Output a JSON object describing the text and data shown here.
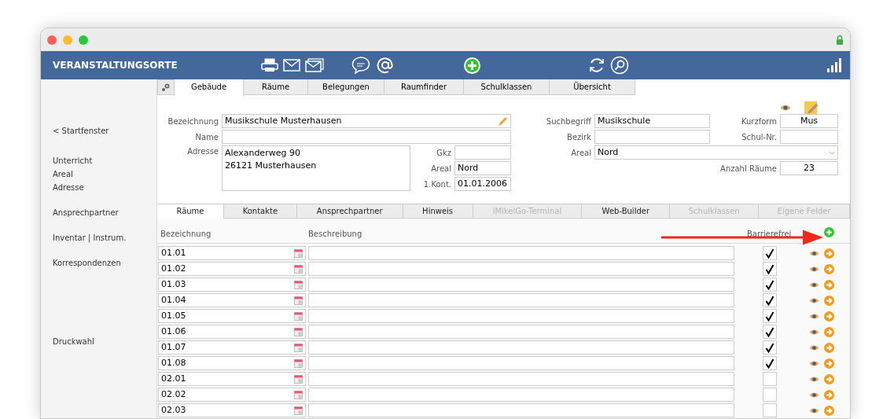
{
  "header": {
    "title": "VERANSTALTUNGSORTE"
  },
  "sidebar": {
    "groups": [
      [
        "< Startfenster"
      ],
      [
        "Unterricht",
        "Areal",
        "Adresse"
      ],
      [
        "Ansprechpartner"
      ],
      [
        "Inventar | Instrum."
      ],
      [
        "Korrespondenzen"
      ],
      [
        "Druckwahl"
      ]
    ]
  },
  "tabs": [
    {
      "label": "Gebäude",
      "selected": true
    },
    {
      "label": "Räume",
      "selected": false
    },
    {
      "label": "Belegungen",
      "selected": false
    },
    {
      "label": "Raumfinder",
      "selected": false
    },
    {
      "label": "Schulklassen",
      "selected": false
    },
    {
      "label": "Übersicht",
      "selected": false
    }
  ],
  "form": {
    "bezeichnung": {
      "label": "Bezeichnung",
      "value": "Musikschule Musterhausen"
    },
    "name": {
      "label": "Name"
    },
    "adresse": {
      "label": "Adresse",
      "lines": [
        "Alexanderweg 90",
        "26121 Musterhausen"
      ]
    },
    "gkz": {
      "label": "Gkz"
    },
    "areal_left": {
      "label": "Areal",
      "value": "Nord"
    },
    "kont": {
      "label": "1.Kont.",
      "value": "01.01.2006"
    },
    "suchbegriff": {
      "label": "Suchbegriff",
      "value": "Musikschule"
    },
    "kurzform": {
      "label": "Kurzform",
      "value": "Mus"
    },
    "bezirk": {
      "label": "Bezirk"
    },
    "schulnr": {
      "label": "Schul-Nr."
    },
    "areal_right": {
      "label": "Areal",
      "value": "Nord"
    },
    "anzahl": {
      "label": "Anzahl Räume",
      "value": "23"
    }
  },
  "sub_tabs": [
    {
      "label": "Räume",
      "selected": true,
      "disabled": false
    },
    {
      "label": "Kontakte",
      "selected": false,
      "disabled": false
    },
    {
      "label": "Ansprechpartner",
      "selected": false,
      "disabled": false
    },
    {
      "label": "Hinweis",
      "selected": false,
      "disabled": false
    },
    {
      "label": "iMikelGo-Terminal",
      "selected": false,
      "disabled": true
    },
    {
      "label": "Web-Builder",
      "selected": false,
      "disabled": false
    },
    {
      "label": "Schulklassen",
      "selected": false,
      "disabled": true
    },
    {
      "label": "Eigene Felder",
      "selected": false,
      "disabled": true
    }
  ],
  "table": {
    "columns": [
      "Bezeichnung",
      "Beschreibung",
      "Barrierefrei"
    ],
    "rows": [
      {
        "name": "01.01",
        "checked": true
      },
      {
        "name": "01.02",
        "checked": true
      },
      {
        "name": "01.03",
        "checked": true
      },
      {
        "name": "01.04",
        "checked": true
      },
      {
        "name": "01.05",
        "checked": true
      },
      {
        "name": "01.06",
        "checked": true
      },
      {
        "name": "01.07",
        "checked": true
      },
      {
        "name": "01.08",
        "checked": true
      },
      {
        "name": "02.01",
        "checked": false
      },
      {
        "name": "02.02",
        "checked": false
      },
      {
        "name": "02.03",
        "checked": false
      }
    ]
  }
}
